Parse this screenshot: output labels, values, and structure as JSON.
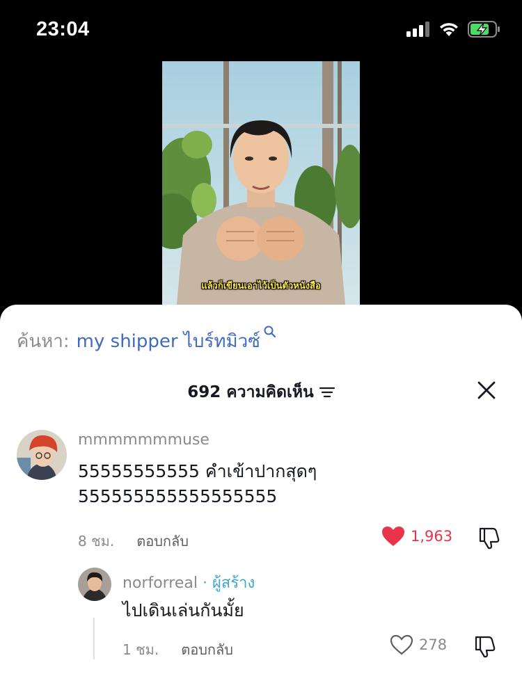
{
  "status_bar": {
    "time": "23:04",
    "icons": [
      "cellular-signal-icon",
      "wifi-icon",
      "battery-charging-icon"
    ]
  },
  "video": {
    "subtitle": "แล้วก็เขียนเอาไว้เป็นตัวหนังสือ"
  },
  "search": {
    "prefix": "ค้นหา:",
    "term": "my shipper ไบร์ทมิวซ์"
  },
  "comments_header": {
    "count_label": "692 ความคิดเห็น"
  },
  "comments": [
    {
      "username": "mmmmmmmuse",
      "text_line1": "55555555555 คำเข้าปากสุดๆ",
      "text_line2": "555555555555555555",
      "time": "8 ชม.",
      "reply_label": "ตอบกลับ",
      "likes": "1,963",
      "liked": true
    },
    {
      "username": "norforreal",
      "badge": " · ผู้สร้าง",
      "text": "ไปเดินเล่นกันมั้ย",
      "time": "1 ชม.",
      "reply_label": "ตอบกลับ",
      "likes": "278",
      "liked": false
    }
  ],
  "colors": {
    "like_red": "#e8334a",
    "search_blue": "#3f6bc2",
    "creator_teal": "#3fa7cc",
    "muted_gray": "#8a8a8a"
  }
}
